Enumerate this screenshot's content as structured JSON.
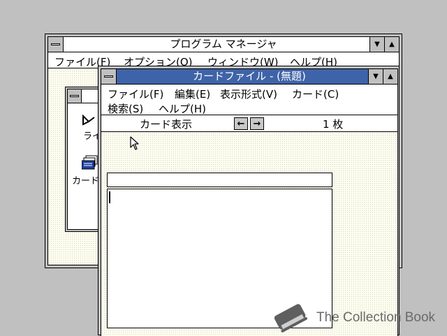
{
  "program_manager": {
    "title": "プログラム マネージャ",
    "menu": [
      "ファイル(F)",
      "オプション(O)",
      "ウィンドウ(W)",
      "ヘルプ(H)"
    ],
    "group_icons": [
      "ライ",
      "カード"
    ]
  },
  "cardfile": {
    "title": "カードファイル - (無題)",
    "menu_row1": [
      "ファイル(F)",
      "編集(E)",
      "表示形式(V)",
      "カード(C)"
    ],
    "menu_row2": [
      "検索(S)",
      "ヘルプ(H)"
    ],
    "view_label": "カード表示",
    "card_count": "1 枚",
    "card_index_text": "",
    "card_body_text": ""
  },
  "watermark": {
    "text": "The Collection Book"
  },
  "colors": {
    "active_title": "#3f63a8",
    "desktop": "#c0c0c0",
    "client_bg": "#fdfdf2"
  },
  "icons": [
    "system-menu-icon",
    "minimize-icon",
    "maximize-icon",
    "left-arrow-icon",
    "right-arrow-icon",
    "arrow-cursor-icon",
    "book-icon",
    "cardfile-icon"
  ]
}
